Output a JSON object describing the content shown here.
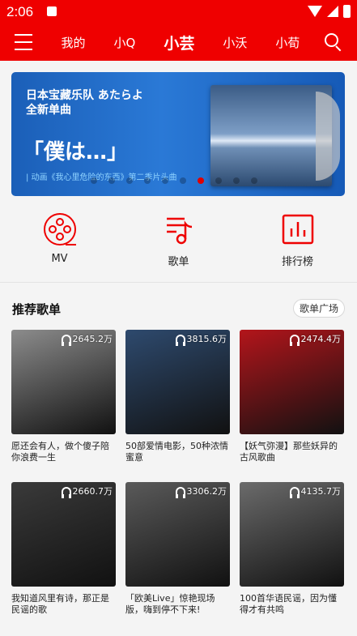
{
  "status": {
    "time": "2:06"
  },
  "tabs": [
    "我的",
    "小Q",
    "小芸",
    "小沃",
    "小荀"
  ],
  "active_tab_index": 2,
  "banner": {
    "line1": "日本宝藏乐队 あたらよ",
    "line2": "全新单曲",
    "big": "「僕は…」",
    "sub": "| 动画《我心里危险的东西》第二季片头曲",
    "page_count": 10,
    "active_page": 6
  },
  "quick": [
    {
      "label": "MV",
      "icon": "film-reel-icon"
    },
    {
      "label": "歌单",
      "icon": "playlist-icon"
    },
    {
      "label": "排行榜",
      "icon": "chart-icon"
    }
  ],
  "section": {
    "title": "推荐歌单",
    "more": "歌单广场"
  },
  "playlists": [
    {
      "count": "2645.2万",
      "title": "愿还会有人，做个傻子陪你浪费一生",
      "color": "#8c8c8c"
    },
    {
      "count": "3815.6万",
      "title": "50部爱情电影，50种浓情蜜意",
      "color": "#2e4a6e"
    },
    {
      "count": "2474.4万",
      "title": "【妖气弥漫】那些妖异的古风歌曲",
      "color": "#b3151b"
    },
    {
      "count": "2660.7万",
      "title": "我知道风里有诗，那正是民谣的歌",
      "color": "#3a3a3a"
    },
    {
      "count": "3306.2万",
      "title": "「欧美Live」惊艳现场版，嗨到停不下来!",
      "color": "#5a5a5a"
    },
    {
      "count": "4135.7万",
      "title": "100首华语民谣，因为懂得才有共鸣",
      "color": "#6b6b6b"
    }
  ],
  "colors": {
    "brand_red": "#ef0000"
  }
}
